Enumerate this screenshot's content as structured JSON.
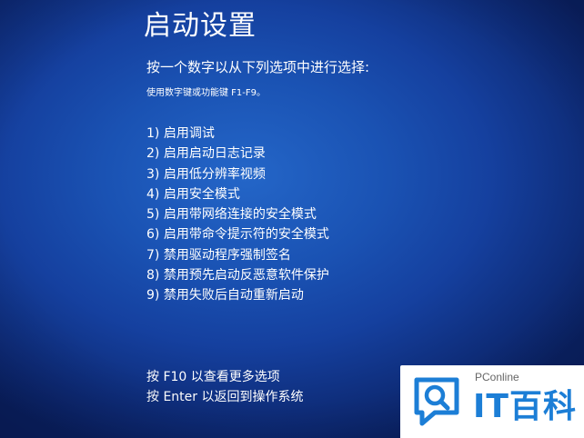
{
  "screen": {
    "title": "启动设置",
    "prompt": "按一个数字以从下列选项中进行选择:",
    "hint": "使用数字键或功能键 F1-F9。",
    "options": [
      "1) 启用调试",
      "2) 启用启动日志记录",
      "3) 启用低分辨率视频",
      "4) 启用安全模式",
      "5) 启用带网络连接的安全模式",
      "6) 启用带命令提示符的安全模式",
      "7) 禁用驱动程序强制签名",
      "8) 禁用预先启动反恶意软件保护",
      "9) 禁用失败后自动重新启动"
    ],
    "footer": {
      "more_options": "按 F10 以查看更多选项",
      "return": "按 Enter 以返回到操作系统"
    }
  },
  "watermark": {
    "brand": "PConline",
    "name": "IT百科",
    "logo_icon": "search-bubble-icon"
  },
  "colors": {
    "background": "#1a52b3",
    "text": "#ffffff",
    "watermark_blue": "#1c7ed6"
  }
}
